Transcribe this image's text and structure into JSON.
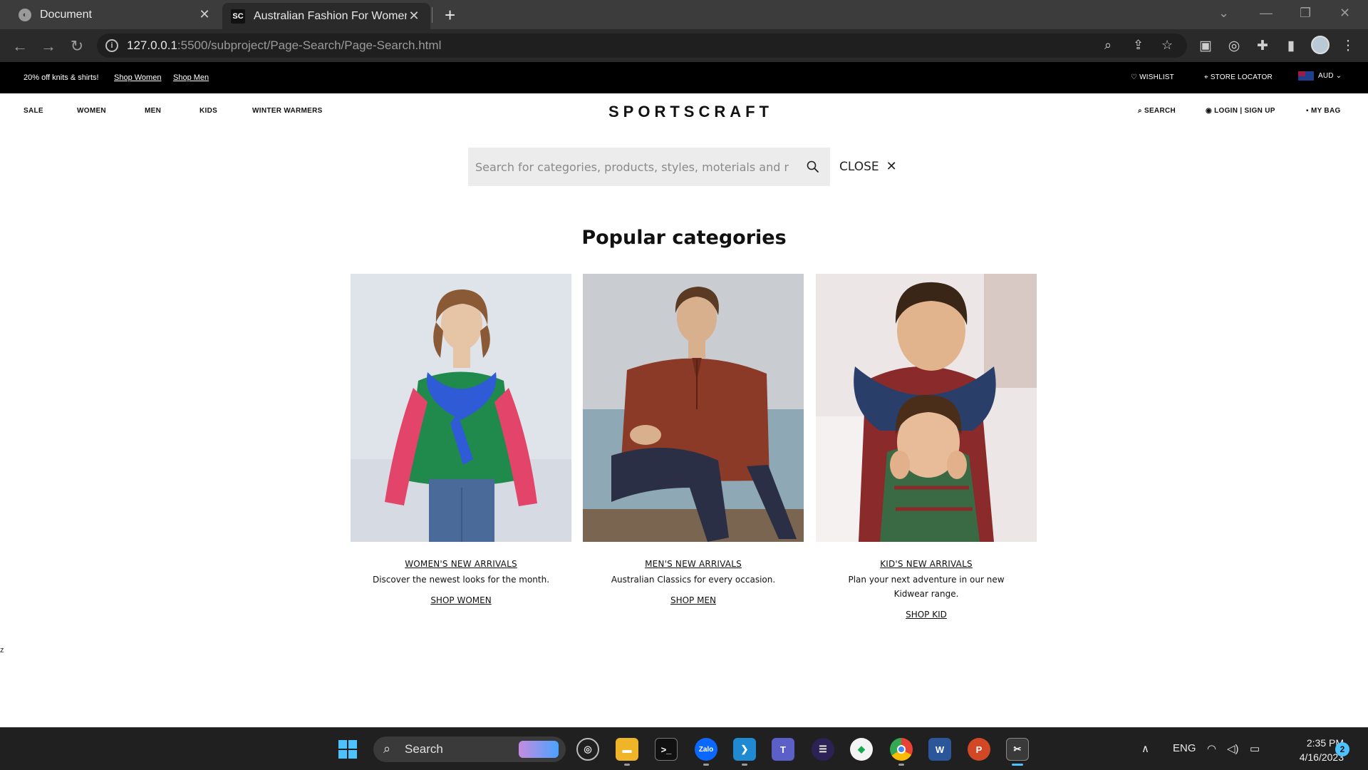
{
  "browser": {
    "tabs": [
      {
        "title": "Document",
        "active": false
      },
      {
        "title": "Australian Fashion For Women &",
        "favicon_text": "SC",
        "active": true
      }
    ],
    "url_host": "127.0.0.1",
    "url_rest": ":5500/subproject/Page-Search/Page-Search.html"
  },
  "promo": {
    "text": "20% off knits & shirts!",
    "link_women": "Shop Women",
    "link_men": "Shop Men",
    "wishlist": "WISHLIST",
    "store_locator": "STORE LOCATOR",
    "currency": "AUD"
  },
  "nav": {
    "items": [
      "SALE",
      "WOMEN",
      "MEN",
      "KIDS",
      "WINTER WARMERS"
    ],
    "logo": "SPORTSCRAFT",
    "search": "SEARCH",
    "login": "LOGIN | SIGN UP",
    "bag": "MY BAG"
  },
  "search": {
    "placeholder": "Search for categories, products, styles, moterials and more",
    "close_label": "CLOSE"
  },
  "section_title": "Popular categories",
  "categories": [
    {
      "title": "WOMEN'S NEW ARRIVALS",
      "description": "Discover the newest looks for the month.",
      "link": "SHOP WOMEN"
    },
    {
      "title": "MEN'S NEW ARRIVALS",
      "description": "Australian Classics for every occasion.",
      "link": "SHOP MEN"
    },
    {
      "title": "KID'S NEW ARRIVALS",
      "description": "Plan your next adventure in our new Kidwear range.",
      "link": "SHOP KID"
    }
  ],
  "stray_text": "z",
  "taskbar": {
    "search_label": "Search",
    "language": "ENG",
    "time": "2:35 PM",
    "date": "4/16/2023",
    "notifications": "2",
    "apps": [
      "windows-start",
      "widgets",
      "file-explorer",
      "terminal",
      "zalo",
      "vscode",
      "teams",
      "eclipse",
      "mongodb-compass",
      "chrome",
      "word",
      "powerpoint",
      "snipping-tool"
    ]
  },
  "colors": {
    "promo_bg": "#000000",
    "search_bg": "#ececec",
    "taskbar_bg": "#202020",
    "chrome_bg": "#3c3c3c"
  }
}
